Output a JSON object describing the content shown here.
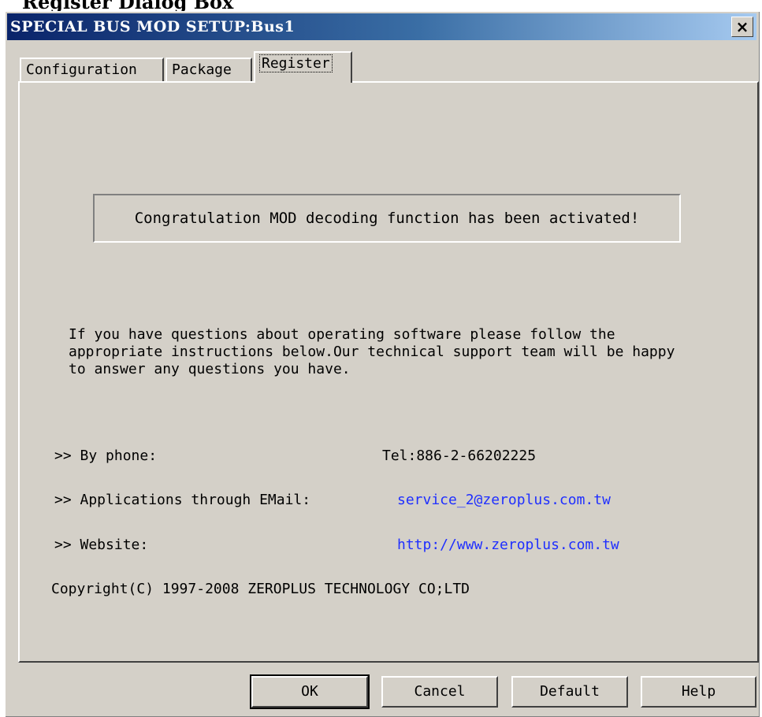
{
  "caption": "Register Dialog Box",
  "window": {
    "title": "SPECIAL BUS MOD SETUP:Bus1",
    "close_glyph": "×"
  },
  "tabs": [
    {
      "label": "Configuration",
      "active": false
    },
    {
      "label": "Package",
      "active": false
    },
    {
      "label": "Register",
      "active": true
    }
  ],
  "register": {
    "status_message": "Congratulation MOD decoding function has been activated!",
    "help_text": "If you have questions about operating software please follow the\nappropriate instructions below.Our technical support team will be happy\nto answer any questions you have.",
    "contacts": [
      {
        "label": ">> By phone:",
        "value": "Tel:886-2-66202225",
        "is_link": false
      },
      {
        "label": ">> Applications through EMail:",
        "value": "service_2@zeroplus.com.tw",
        "is_link": true
      },
      {
        "label": ">> Website:",
        "value": "http://www.zeroplus.com.tw",
        "is_link": true
      }
    ],
    "copyright": "Copyright(C) 1997-2008 ZEROPLUS TECHNOLOGY CO;LTD"
  },
  "buttons": {
    "ok": "OK",
    "cancel": "Cancel",
    "default": "Default",
    "help": "Help"
  },
  "colors": {
    "titlebar_start": "#0a246a",
    "titlebar_end": "#a6caf0",
    "dialog_bg": "#d4d0c8",
    "link": "#1f2fff"
  }
}
